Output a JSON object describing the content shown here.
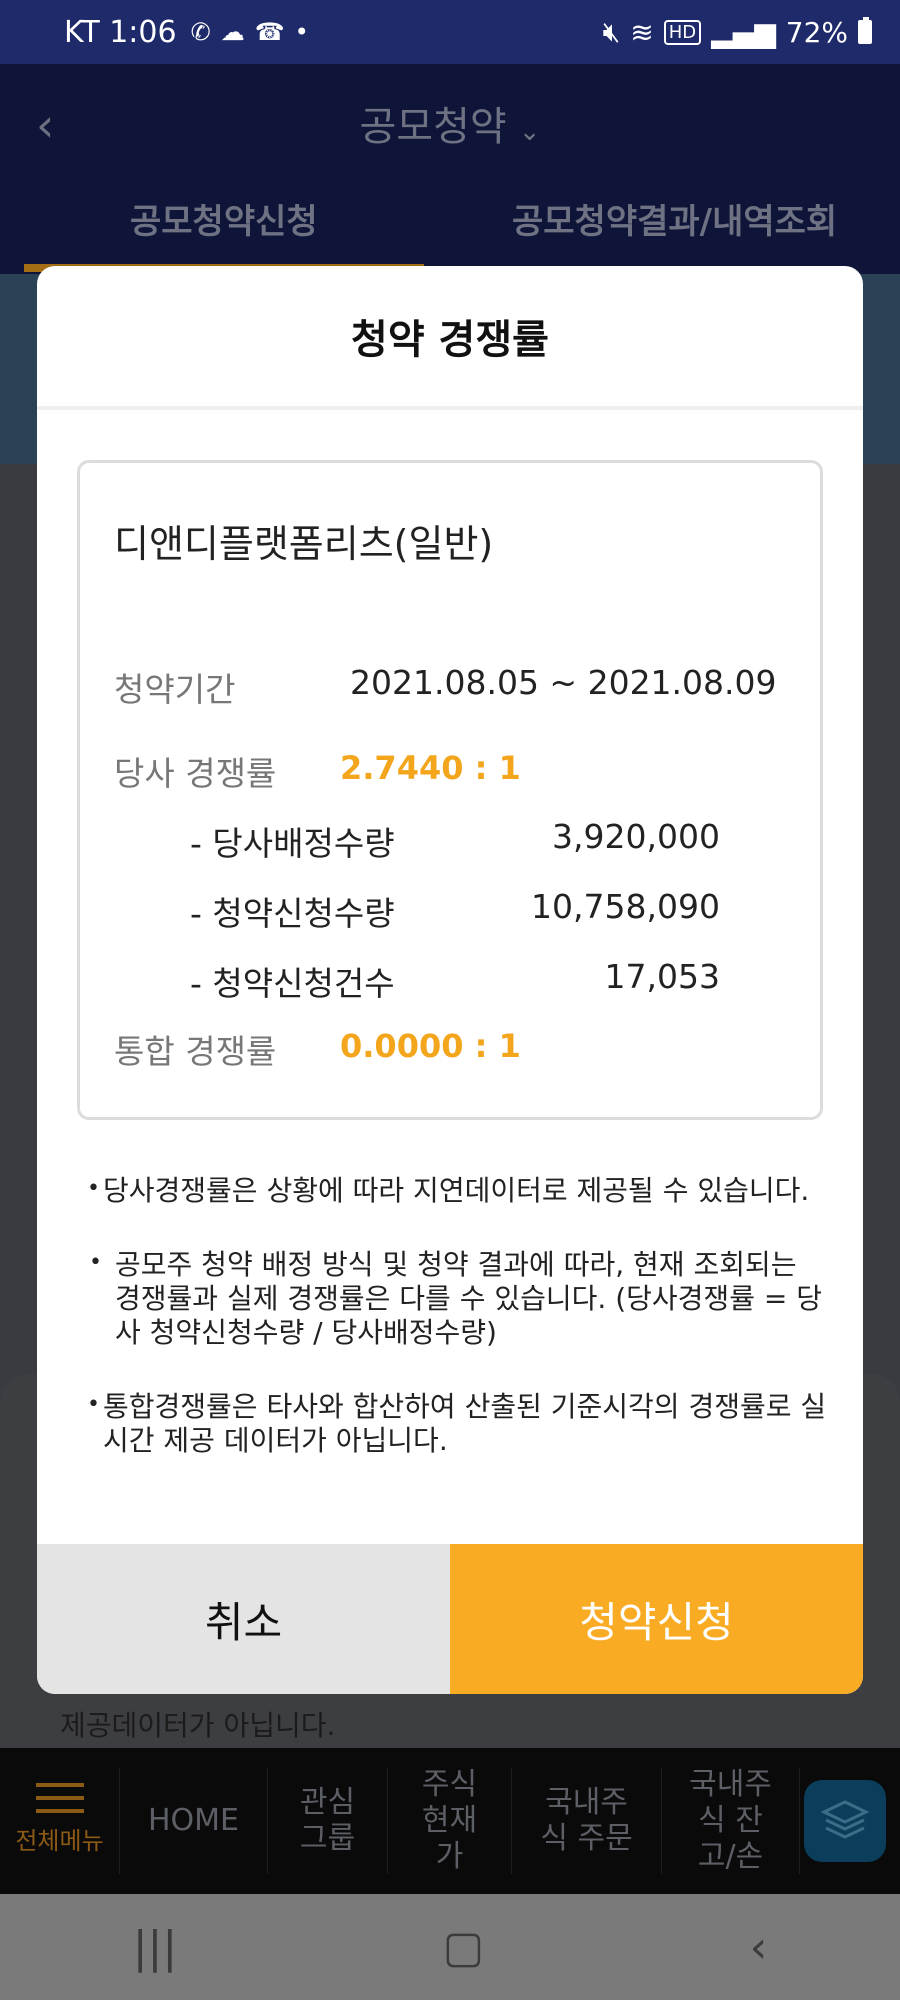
{
  "status_bar": {
    "carrier_time": "KT 1:06",
    "battery": "72%",
    "icons_left": [
      "volte-icon",
      "weather-icon",
      "wifi-call-icon",
      "dot-icon"
    ],
    "icons_right": [
      "mute-icon",
      "wifi-icon",
      "hd-icon",
      "signal-icon",
      "battery-icon"
    ]
  },
  "header": {
    "title": "공모청약",
    "tabs": [
      "공모청약신청",
      "공모청약결과/내역조회"
    ]
  },
  "background": {
    "footer_text": "제공데이터가 아닙니다."
  },
  "modal": {
    "title": "청약 경쟁률",
    "stock_name": "디앤디플랫폼리츠(일반)",
    "period_label": "청약기간",
    "period_value": "2021.08.05 ~ 2021.08.09",
    "company_ratio_label": "당사 경쟁률",
    "company_ratio_value": "2.7440 : 1",
    "allocation_label": "- 당사배정수량",
    "allocation_value": "3,920,000",
    "applied_qty_label": "- 청약신청수량",
    "applied_qty_value": "10,758,090",
    "applied_count_label": "- 청약신청건수",
    "applied_count_value": "17,053",
    "total_ratio_label": "통합 경쟁률",
    "total_ratio_value": "0.0000 : 1",
    "notes": [
      "당사경쟁률은 상황에 따라 지연데이터로 제공될 수 있습니다.",
      "공모주 청약 배정 방식 및 청약 결과에 따라, 현재 조회되는 경쟁률과 실제 경쟁률은 다를 수 있습니다. (당사경쟁률 = 당사 청약신청수량 / 당사배정수량)",
      "통합경쟁률은 타사와 합산하여 산출된 기준시각의 경쟁률로 실시간 제공 데이터가 아닙니다."
    ],
    "cancel_label": "취소",
    "apply_label": "청약신청"
  },
  "bottom_nav": {
    "items": [
      "전체메뉴",
      "HOME",
      "관심 그룹",
      "주식 현재가",
      "국내주식 주문",
      "국내주식 잔고/손"
    ]
  },
  "colors": {
    "accent": "#f9ab24",
    "header_bg": "#1f2a6b"
  }
}
